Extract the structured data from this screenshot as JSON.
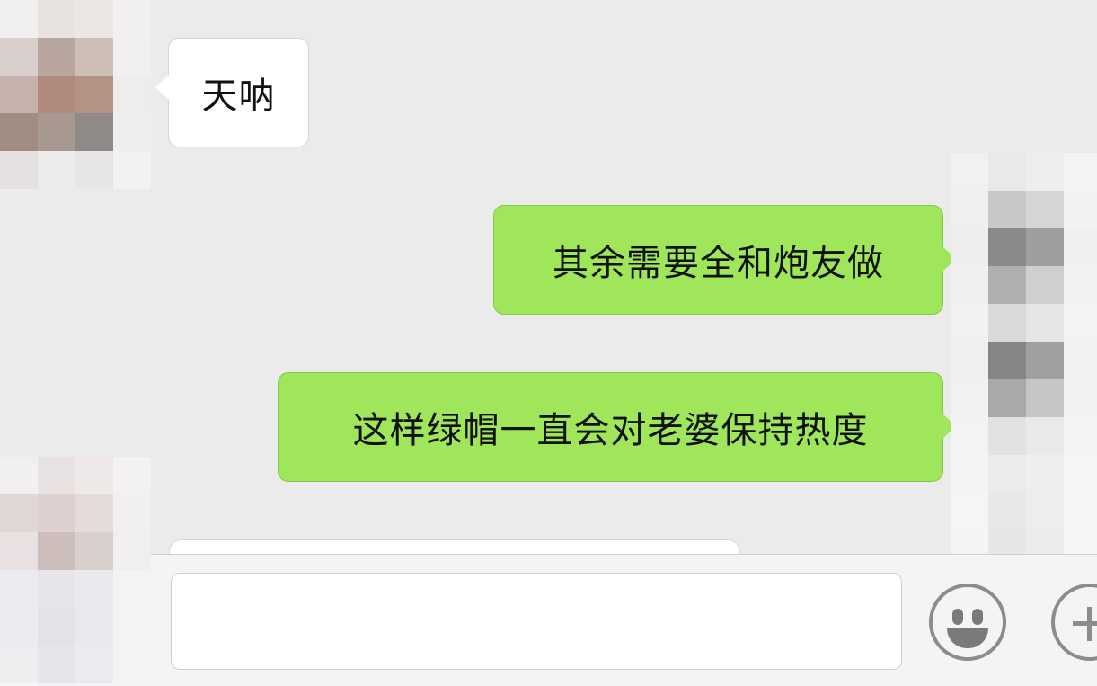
{
  "messages": [
    {
      "direction": "incoming",
      "text": "天呐"
    },
    {
      "direction": "outgoing",
      "text": "其余需要全和炮友做"
    },
    {
      "direction": "outgoing",
      "text": "这样绿帽一直会对老婆保持热度"
    }
  ],
  "avatars": {
    "left_top": [
      "#f0eeee",
      "#e8e2e1",
      "#ece6e4",
      "#f1efef",
      "#d9cfcd",
      "#b9a59f",
      "#cdbfb8",
      "#f0eeee",
      "#c5b2ac",
      "#b08a7e",
      "#b49386",
      "#efecec",
      "#a08c81",
      "#a79990",
      "#8f8988",
      "#efeeee",
      "#e6e1e1",
      "#ececec",
      "#e7e5e5",
      "#f2f2f2"
    ],
    "right": [
      "#f1f1f1",
      "#e9e9e9",
      "#eeeeee",
      "#f4f4f4",
      "#efefef",
      "#c8c8c8",
      "#d6d6d6",
      "#f2f2f2",
      "#eeeeee",
      "#8a8a8a",
      "#9e9e9e",
      "#f0f0f0",
      "#f0f0f0",
      "#b0b0b0",
      "#cfcfcf",
      "#f2f2f2",
      "#f1f1f1",
      "#dadada",
      "#e5e5e5",
      "#f3f3f3",
      "#f0f0f0",
      "#858585",
      "#a0a0a0",
      "#f1f1f1",
      "#f1f1f1",
      "#a9a9a9",
      "#c6c6c6",
      "#f2f2f2",
      "#f3f3f3",
      "#e2e2e2",
      "#e9e9e9",
      "#f4f4f4",
      "#f4f4f4",
      "#ebebeb",
      "#eeeeee",
      "#f5f5f5",
      "#f5f5f5",
      "#e8e8e8",
      "#ededed",
      "#f6f6f6",
      "#f4f4f4",
      "#e6e6e6",
      "#ececec",
      "#f5f5f5",
      "#f4f4f4",
      "#e4e4e4",
      "#ebebeb",
      "#f5f5f5",
      "#f5f5f5",
      "#e9e9e9",
      "#efefef",
      "#f6f6f6",
      "#f5f5f5",
      "#ececec",
      "#f0f0f0",
      "#f6f6f6"
    ],
    "left_bottom": [
      "#f1efef",
      "#e9e2e2",
      "#eee8e8",
      "#f3f1f1",
      "#e1d7d7",
      "#ddd0ce",
      "#e4dcdb",
      "#f1efef",
      "#e9e1e1",
      "#cdbebb",
      "#d9cfcd",
      "#f0eeee",
      "#ececf0",
      "#e5e5ea",
      "#eaeaee",
      "#f3f3f5",
      "#ececf0",
      "#e2e2e7",
      "#e9e9ed",
      "#f3f3f5",
      "#eeeef1",
      "#e6e6ea",
      "#ebebef",
      "#f4f4f6"
    ]
  },
  "colors": {
    "chat_background": "#ebebeb",
    "outgoing_bubble": "#9fe65b",
    "incoming_bubble": "#ffffff",
    "input_bar": "#f4f4f6"
  },
  "input": {
    "voice_icon": "voice-icon",
    "emoji_icon": "emoji-icon",
    "more_icon": "plus-icon"
  }
}
